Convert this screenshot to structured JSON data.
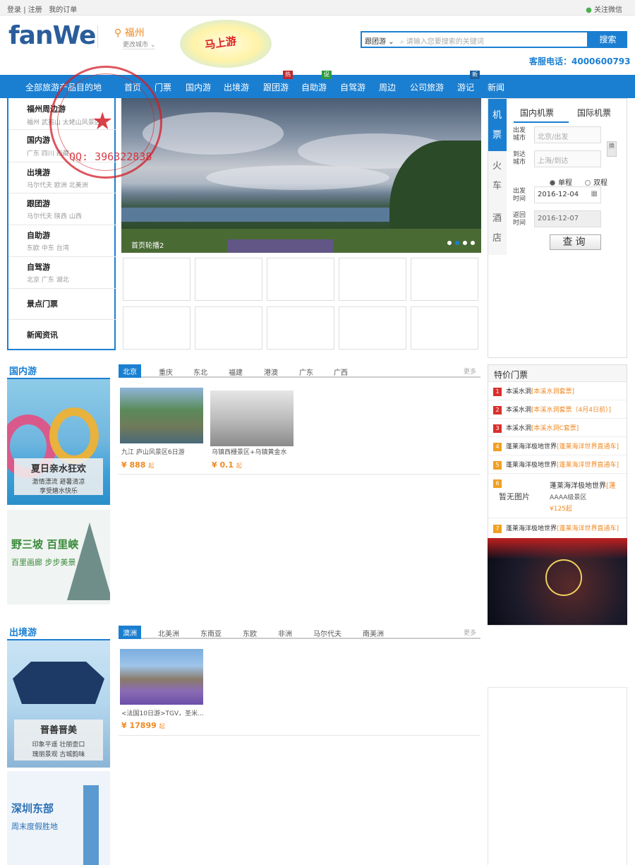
{
  "topbar": {
    "login": "登录",
    "sep": "|",
    "register": "注册",
    "orders": "我的订单",
    "wechat": "关注微信"
  },
  "header": {
    "logo": "fanWe",
    "city": "福州",
    "city_change": "更改城市",
    "ad_text": "马上游",
    "search_type": "跟团游",
    "search_placeholder": "请输入您要搜索的关键词",
    "search_button": "搜索",
    "hotline": "客服电话：4000600793"
  },
  "nav": {
    "all": "全部旅游产品目的地",
    "items": [
      {
        "label": "首页"
      },
      {
        "label": "门票"
      },
      {
        "label": "国内游"
      },
      {
        "label": "出境游"
      },
      {
        "label": "跟团游",
        "tag": "热"
      },
      {
        "label": "自助游",
        "tag": "促"
      },
      {
        "label": "自驾游"
      },
      {
        "label": "周边"
      },
      {
        "label": "公司旅游"
      },
      {
        "label": "游记",
        "tag": "新"
      },
      {
        "label": "新闻"
      }
    ]
  },
  "categories": [
    {
      "name": "福州周边游",
      "sub": "福州 武夷山 太姥山风景区"
    },
    {
      "name": "国内游",
      "sub": "广东 四川 西藏"
    },
    {
      "name": "出境游",
      "sub": "马尔代夫 欧洲 北美洲"
    },
    {
      "name": "跟团游",
      "sub": "马尔代夫 陕西 山西"
    },
    {
      "name": "自助游",
      "sub": "东欧 中东 台湾"
    },
    {
      "name": "自驾游",
      "sub": "北京 广东 湖北"
    },
    {
      "name": "景点门票",
      "sub": ""
    },
    {
      "name": "新闻资讯",
      "sub": ""
    }
  ],
  "stamp": {
    "text": "精品源码小店",
    "qq": "QQ: 396322838"
  },
  "hero": {
    "caption": "首页轮播2"
  },
  "ticket": {
    "vtabs": [
      "机票",
      "火车",
      "酒店"
    ],
    "tabs": [
      "国内机票",
      "国际机票"
    ],
    "depart_label": "出发城市",
    "depart_placeholder": "北京/出发",
    "arrive_label": "到达城市",
    "arrive_placeholder": "上海/到达",
    "swap": "换",
    "oneway": "单程",
    "roundtrip": "双程",
    "depart_time_label": "出发时间",
    "depart_date": "2016-12-04",
    "return_label": "返回时间",
    "return_date": "2016-12-07",
    "query": "查询"
  },
  "domestic": {
    "title": "国内游",
    "tabs": [
      "北京",
      "重庆",
      "东北",
      "福建",
      "港澳",
      "广东",
      "广西"
    ],
    "more": "更多",
    "promo1": {
      "title": "夏日亲水狂欢",
      "line1": "激情漂流 避暑清凉",
      "line2": "享受嬉水快乐"
    },
    "promo2": {
      "title": "野三坡 百里峡",
      "line1": "百里画廊 步步美景"
    },
    "products": [
      {
        "name": "九江 庐山风景区6日游",
        "price": "¥ 888",
        "unit": "起"
      },
      {
        "name": "乌镇西栅景区+乌镇黄金水",
        "price": "¥ 0.1",
        "unit": "起"
      }
    ]
  },
  "outbound": {
    "title": "出境游",
    "tabs": [
      "澳洲",
      "北美洲",
      "东南亚",
      "东欧",
      "非洲",
      "马尔代夫",
      "南美洲"
    ],
    "more": "更多",
    "promo1": {
      "title": "晋善晋美",
      "line1": "印象平遥 壮丽壶口",
      "line2": "瑰丽景观 古城韵味"
    },
    "promo2": {
      "title": "深圳东部",
      "line1": "周末度假胜地"
    },
    "products": [
      {
        "name": "<法国10日游>TGV，圣米...",
        "price": "¥ 17899",
        "unit": "起"
      }
    ]
  },
  "special": {
    "title": "特价门票",
    "rows": [
      {
        "num": "1",
        "name": "本溪水洞",
        "tag": "[本溪水洞套票]"
      },
      {
        "num": "2",
        "name": "本溪水洞",
        "tag": "[本溪水洞套票（4月4日前）]"
      },
      {
        "num": "3",
        "name": "本溪水洞",
        "tag": "[本溪水洞C套票]"
      },
      {
        "num": "4",
        "name": "蓬莱海洋极地世界",
        "tag": "[蓬莱海洋世界直通车]"
      },
      {
        "num": "5",
        "name": "蓬莱海洋极地世界",
        "tag": "[蓬莱海洋世界直通车]"
      },
      {
        "num": "6",
        "name": "蓬莱海洋极地世界",
        "tag": "[蓬",
        "noimg": "暂无图片",
        "level": "AAAA级景区",
        "price": "¥125起"
      },
      {
        "num": "7",
        "name": "蓬莱海洋极地世界",
        "tag": "[蓬莱海洋世界直通车]"
      }
    ]
  },
  "colors": {
    "brand": "#1b7fd1",
    "accent": "#f08a24",
    "red": "#d9302c"
  }
}
